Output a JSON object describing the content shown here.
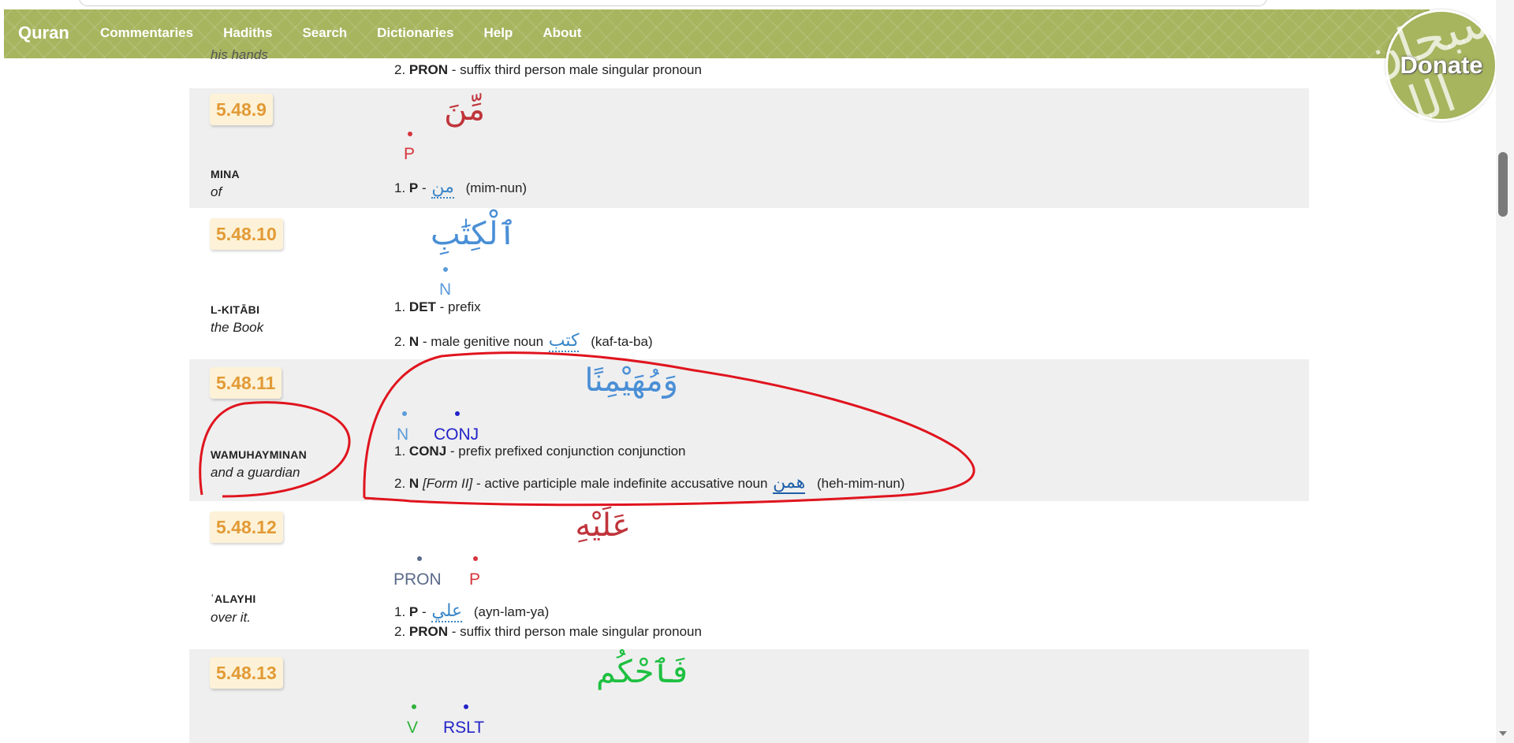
{
  "nav": {
    "brand": "Quran",
    "links": [
      "Commentaries",
      "Hadiths",
      "Search",
      "Dictionaries",
      "Help",
      "About"
    ]
  },
  "donate": {
    "label": "Donate",
    "calligraphy": "سبحان الله"
  },
  "prev_row": {
    "gloss_partial": "his hands",
    "line2_num": "2.",
    "line2_tag": "PRON",
    "line2_text": " - suffix third person male singular pronoun"
  },
  "rows": [
    {
      "id": "5.48.9",
      "translit": "MINA",
      "gloss": "of",
      "arabic": "مِّنَ",
      "arabic_color": "#c0343b",
      "tags": [
        {
          "label": "P",
          "color": "#d7343b"
        }
      ],
      "lines": [
        {
          "num": "1.",
          "tag": "P",
          "text": " - ",
          "root_ar": "من",
          "root": "(mim-nun)"
        }
      ]
    },
    {
      "id": "5.48.10",
      "translit": "L-KITĀBI",
      "gloss": "the Book",
      "arabic": "ٱلْكِتَٰبِ",
      "arabic_color": "#4a8fd6",
      "tags": [
        {
          "label": "N",
          "color": "#5b9bd9"
        }
      ],
      "lines": [
        {
          "num": "1.",
          "tag": "DET",
          "text": " - prefix"
        },
        {
          "num": "2.",
          "tag": "N",
          "text": " - male genitive noun ",
          "root_ar": "كتب",
          "root": "(kaf-ta-ba)"
        }
      ]
    },
    {
      "id": "5.48.11",
      "translit": "WAMUHAYMINAN",
      "gloss": "and a guardian",
      "arabic": "وَمُهَيْمِنًا",
      "arabic_color": "#4a8fd6",
      "tags": [
        {
          "label": "N",
          "color": "#5b9bd9"
        },
        {
          "label": "CONJ",
          "color": "#2323c8"
        }
      ],
      "lines": [
        {
          "num": "1.",
          "tag": "CONJ",
          "text": " - prefix prefixed conjunction conjunction"
        },
        {
          "num": "2.",
          "tag": "N",
          "form": "[Form II]",
          "text": " - active participle male indefinite accusative noun ",
          "root_ar": "همن",
          "root": "(heh-mim-nun)"
        }
      ]
    },
    {
      "id": "5.48.12",
      "translit": "ʿALAYHI",
      "gloss": "over it.",
      "arabic": "عَلَيْهِ",
      "arabic_color": "#c0343b",
      "tags": [
        {
          "label": "PRON",
          "color": "#5a6a8a"
        },
        {
          "label": "P",
          "color": "#d7343b"
        }
      ],
      "lines": [
        {
          "num": "1.",
          "tag": "P",
          "text": " - ",
          "root_ar": "علي",
          "root": "(ayn-lam-ya)"
        },
        {
          "num": "2.",
          "tag": "PRON",
          "text": " - suffix third person male singular pronoun"
        }
      ]
    },
    {
      "id": "5.48.13",
      "translit": "",
      "gloss": "",
      "arabic": "فَٱحْكُم",
      "arabic_color": "#1ec040",
      "tags": [
        {
          "label": "V",
          "color": "#2db33a"
        },
        {
          "label": "RSLT",
          "color": "#2323c8"
        }
      ],
      "lines": []
    }
  ],
  "colors": {
    "nav_bg": "#a6b55e",
    "badge_text": "#e29a35",
    "annotation": "#e0141e"
  }
}
